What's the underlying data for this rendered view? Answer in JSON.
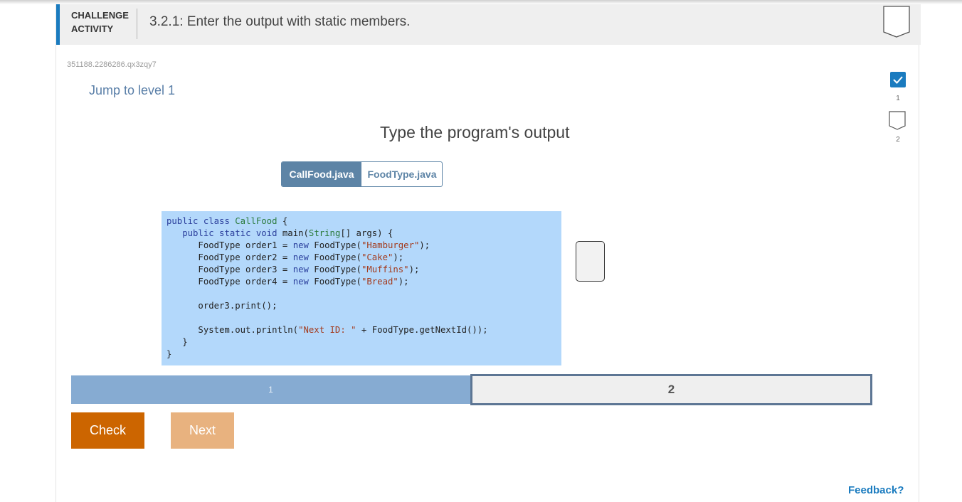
{
  "header": {
    "label_line1": "CHALLENGE",
    "label_line2": "ACTIVITY",
    "title": "3.2.1: Enter the output with static members."
  },
  "activity_id": "351188.2286286.qx3zqy7",
  "jump_link": "Jump to level 1",
  "levels": [
    {
      "number": "1",
      "completed": true
    },
    {
      "number": "2",
      "completed": false
    }
  ],
  "prompt": "Type the program's output",
  "tabs": [
    {
      "label": "CallFood.java",
      "active": true
    },
    {
      "label": "FoodType.java",
      "active": false
    }
  ],
  "code": [
    "public class CallFood {",
    "   public static void main(String[] args) {",
    "      FoodType order1 = new FoodType(\"Hamburger\");",
    "      FoodType order2 = new FoodType(\"Cake\");",
    "      FoodType order3 = new FoodType(\"Muffins\");",
    "      FoodType order4 = new FoodType(\"Bread\");",
    "",
    "      order3.print();",
    "",
    "      System.out.println(\"Next ID: \" + FoodType.getNextId());",
    "   }",
    "}"
  ],
  "output_answer": "",
  "progress": [
    {
      "label": "1",
      "state": "completed"
    },
    {
      "label": "2",
      "state": "current"
    }
  ],
  "buttons": {
    "check": "Check",
    "next": "Next"
  },
  "feedback": "Feedback?",
  "colors": {
    "accent": "#1a7bbf",
    "code_bg": "#b3d8fb",
    "check_btn": "#cc6500",
    "next_btn_disabled": "#e8b27f",
    "progress_done": "#86abd2",
    "tab_active": "#5d84a6"
  }
}
